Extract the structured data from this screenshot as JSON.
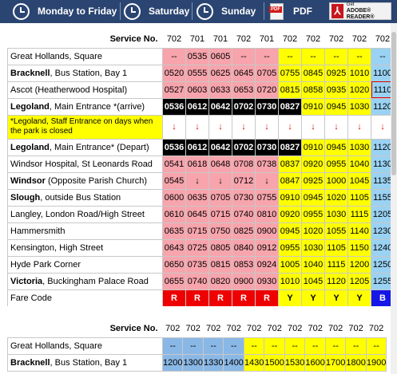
{
  "nav": {
    "monday_friday": "Monday to Friday",
    "saturday": "Saturday",
    "sunday": "Sunday",
    "pdf": "PDF",
    "reader_get": "Get",
    "reader_name": "ADOBE® READER®",
    "pdf_badge": "PDF"
  },
  "colors": {
    "nav_bg": "#2b4572",
    "red_band": "#f7a4ac",
    "yellow_band": "#ffff00",
    "blue_band": "#9ad2f3"
  },
  "table1": {
    "service_label": "Service No.",
    "services": [
      "702",
      "701",
      "701",
      "702",
      "701",
      "702",
      "702",
      "702",
      "702",
      "702"
    ],
    "rows": [
      {
        "stop": "Great Hollands, Square",
        "bold_part": "",
        "times": [
          "--",
          "0535",
          "0605",
          "--",
          "--",
          "--",
          "--",
          "--",
          "--",
          "--"
        ]
      },
      {
        "stop": ", Bus Station, Bay 1",
        "bold_part": "Bracknell",
        "times": [
          "0520",
          "0555",
          "0625",
          "0645",
          "0705",
          "0755",
          "0845",
          "0925",
          "1010",
          "1100"
        ]
      },
      {
        "stop": "Ascot (Heatherwood Hospital)",
        "bold_part": "",
        "times": [
          "0527",
          "0603",
          "0633",
          "0653",
          "0720",
          "0815",
          "0858",
          "0935",
          "1020",
          "1110"
        ]
      },
      {
        "stop": ", Main Entrance *(arrive)",
        "bold_part": "Legoland",
        "times": [
          "0536",
          "0612",
          "0642",
          "0702",
          "0730",
          "0827",
          "0910",
          "0945",
          "1030",
          "1120"
        ]
      }
    ],
    "note": "*Legoland, Staff Entrance on days when the park is closed",
    "arrow": "↓",
    "rows2": [
      {
        "stop": ", Main Entrance* (Depart)",
        "bold_part": "Legoland",
        "times": [
          "0536",
          "0612",
          "0642",
          "0702",
          "0730",
          "0827",
          "0910",
          "0945",
          "1030",
          "1120"
        ]
      },
      {
        "stop": "Windsor Hospital, St Leonards Road",
        "bold_part": "",
        "times": [
          "0541",
          "0618",
          "0648",
          "0708",
          "0738",
          "0837",
          "0920",
          "0955",
          "1040",
          "1130"
        ]
      },
      {
        "stop": " (Opposite Parish Church)",
        "bold_part": "Windsor",
        "times": [
          "0545",
          "↓",
          "↓",
          "0712",
          "↓",
          "0847",
          "0925",
          "1000",
          "1045",
          "1135"
        ]
      },
      {
        "stop": ", outside Bus Station",
        "bold_part": "Slough",
        "times": [
          "0600",
          "0635",
          "0705",
          "0730",
          "0755",
          "0910",
          "0945",
          "1020",
          "1105",
          "1155"
        ]
      },
      {
        "stop": "Langley, London Road/High Street",
        "bold_part": "",
        "times": [
          "0610",
          "0645",
          "0715",
          "0740",
          "0810",
          "0920",
          "0955",
          "1030",
          "1115",
          "1205"
        ]
      },
      {
        "stop": "Hammersmith",
        "bold_part": "",
        "times": [
          "0635",
          "0715",
          "0750",
          "0825",
          "0900",
          "0945",
          "1020",
          "1055",
          "1140",
          "1230"
        ]
      },
      {
        "stop": "Kensington, High Street",
        "bold_part": "",
        "times": [
          "0643",
          "0725",
          "0805",
          "0840",
          "0912",
          "0955",
          "1030",
          "1105",
          "1150",
          "1240"
        ]
      },
      {
        "stop": "Hyde Park Corner",
        "bold_part": "",
        "times": [
          "0650",
          "0735",
          "0815",
          "0853",
          "0924",
          "1005",
          "1040",
          "1115",
          "1200",
          "1250"
        ]
      },
      {
        "stop": ", Buckingham Palace Road",
        "bold_part": "Victoria",
        "times": [
          "0655",
          "0740",
          "0820",
          "0900",
          "0930",
          "1010",
          "1045",
          "1120",
          "1205",
          "1255"
        ]
      }
    ],
    "fare_label": "Fare Code",
    "fares": [
      "R",
      "R",
      "R",
      "R",
      "R",
      "Y",
      "Y",
      "Y",
      "Y",
      "B"
    ]
  },
  "table2": {
    "service_label": "Service No.",
    "services": [
      "702",
      "702",
      "702",
      "702",
      "702",
      "702",
      "702",
      "702",
      "702",
      "702",
      "702"
    ],
    "rows": [
      {
        "stop": "Great Hollands, Square",
        "bold_part": "",
        "times": [
          "--",
          "--",
          "--",
          "--",
          "--",
          "--",
          "--",
          "--",
          "--",
          "--",
          "--"
        ]
      },
      {
        "stop": ", Bus Station, Bay 1",
        "bold_part": "Bracknell",
        "times": [
          "1200",
          "1300",
          "1330",
          "1400",
          "1430",
          "1500",
          "1530",
          "1600",
          "1700",
          "1800",
          "1900"
        ]
      }
    ]
  }
}
